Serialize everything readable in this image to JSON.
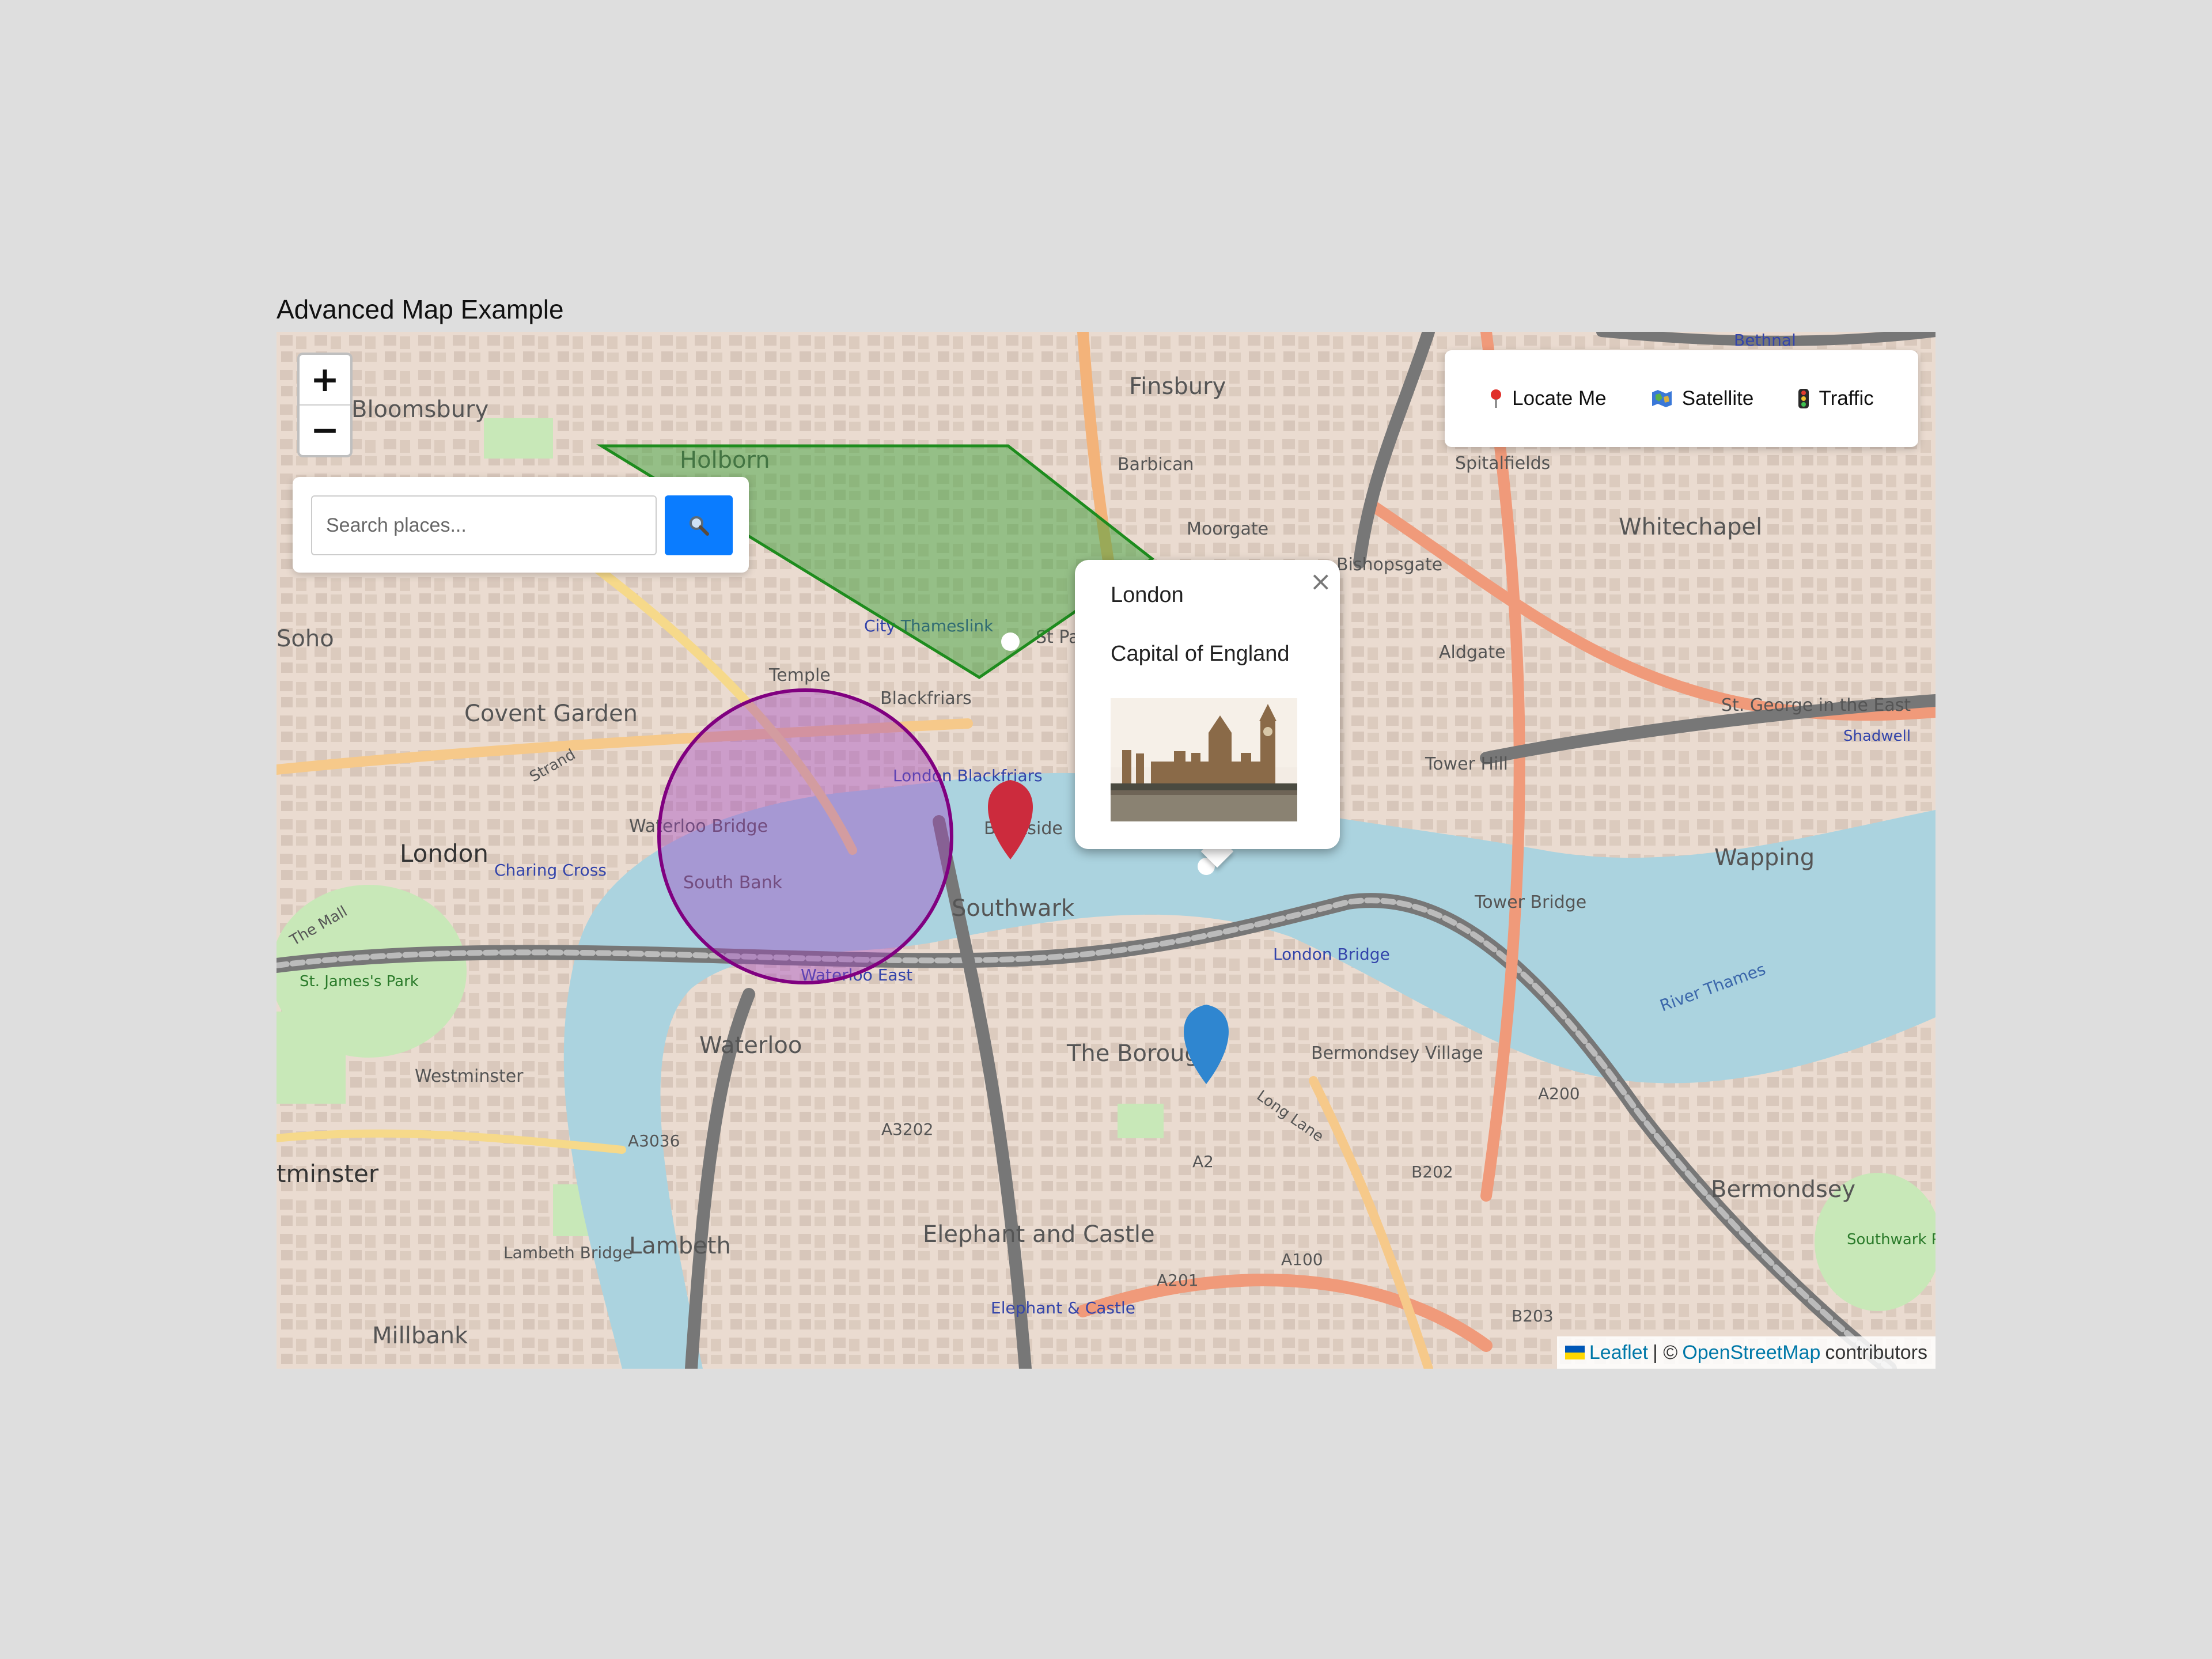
{
  "page": {
    "title": "Advanced Map Example"
  },
  "zoom": {
    "in": "+",
    "out": "−"
  },
  "search": {
    "placeholder": "Search places...",
    "button_icon": "magnifier-icon"
  },
  "controls": [
    {
      "icon": "pin-icon",
      "label": "Locate Me"
    },
    {
      "icon": "globe-map-icon",
      "label": "Satellite"
    },
    {
      "icon": "traffic-light-icon",
      "label": "Traffic"
    }
  ],
  "popup": {
    "title": "London",
    "description": "Capital of England",
    "image": "houses-of-parliament-photo",
    "close": "×"
  },
  "attribution": {
    "leaflet": "Leaflet",
    "separator": "| ©",
    "osm": "OpenStreetMap",
    "suffix": "contributors"
  },
  "overlays": {
    "polygon_color": "#1e8c1e",
    "circle_color": "#800080",
    "marker_red": "#cc2b3d",
    "marker_blue": "#2f86d0"
  },
  "map_labels": {
    "bloomsbury": "Bloomsbury",
    "holborn": "Holborn",
    "finsbury": "Finsbury",
    "barbican": "Barbican",
    "moorgate": "Moorgate",
    "bishopsgate": "Bishopsgate",
    "spitalfields": "Spitalfields",
    "whitechapel": "Whitechapel",
    "bethnal": "Bethnal",
    "soho": "Soho",
    "covent_garden": "Covent Garden",
    "temple": "Temple",
    "blackfriars": "Blackfriars",
    "city_thameslink": "City Thameslink",
    "st_paul": "St Pa",
    "london_blackfriars": "London Blackfriars",
    "bankside": "Bankside",
    "aldgate": "Aldgate",
    "tower_hill": "Tower Hill",
    "st_george": "St. George in the East",
    "shadwell": "Shadwell",
    "wapping": "Wapping",
    "london": "London",
    "charing_cross": "Charing Cross",
    "waterloo_bridge": "Waterloo Bridge",
    "south_bank": "South Bank",
    "southwark": "Southwark",
    "tower_bridge": "Tower Bridge",
    "london_bridge": "London Bridge",
    "waterloo_east": "Waterloo East",
    "waterloo": "Waterloo",
    "the_borough": "The Borough",
    "bermondsey_village": "Bermondsey Village",
    "westminster": "Westminster",
    "tminster": "tminster",
    "a3036": "A3036",
    "a3202": "A3202",
    "a2": "A2",
    "b202": "B202",
    "a200": "A200",
    "a100": "A100",
    "a201": "A201",
    "b203": "B203",
    "lambeth": "Lambeth",
    "lambeth_bridge": "Lambeth Bridge",
    "elephant_castle": "Elephant and Castle",
    "elephant_station": "Elephant & Castle",
    "bermondsey": "Bermondsey",
    "millbank": "Millbank",
    "st_james_park": "St. James's Park",
    "southwark_park": "Southwark Park",
    "river_thames": "River Thames",
    "long_lane": "Long Lane",
    "the_mall": "The Mall",
    "strand": "Strand"
  }
}
